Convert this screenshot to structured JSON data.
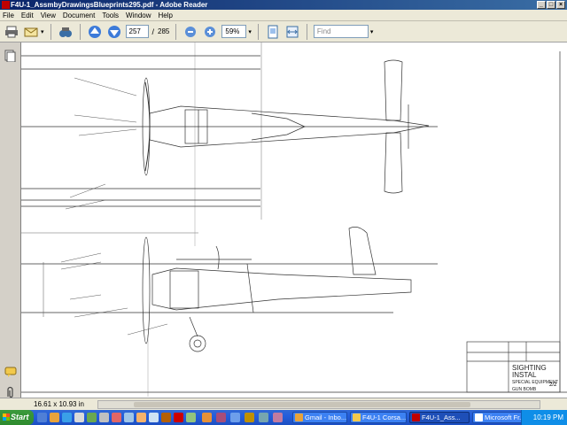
{
  "window": {
    "title": "F4U-1_AssmbyDrawingsBlueprints295.pdf - Adobe Reader"
  },
  "menu": [
    "File",
    "Edit",
    "View",
    "Document",
    "Tools",
    "Window",
    "Help"
  ],
  "toolbar": {
    "page_current": "257",
    "page_sep": "/",
    "page_total": "285",
    "zoom": "59%",
    "find_placeholder": "Find"
  },
  "document": {
    "title_block": {
      "line1": "SIGHTING INSTAL",
      "line2": "SPECIAL EQUIPMENT",
      "line3": "GUN BOMB",
      "sheet": "2/2"
    }
  },
  "status": {
    "page_size": "16.61 x 10.93 in"
  },
  "taskbar": {
    "start": "Start",
    "tasks": [
      "Gmail - Inbo...",
      "F4U-1 Corsa...",
      "F4U-1_Ass...",
      "Microsoft Fr..."
    ],
    "chevron": "«",
    "clock": "10:19 PM"
  },
  "colors": {
    "titlebar": "#0a246a",
    "taskbar": "#245edb",
    "start": "#2e8b2e"
  }
}
